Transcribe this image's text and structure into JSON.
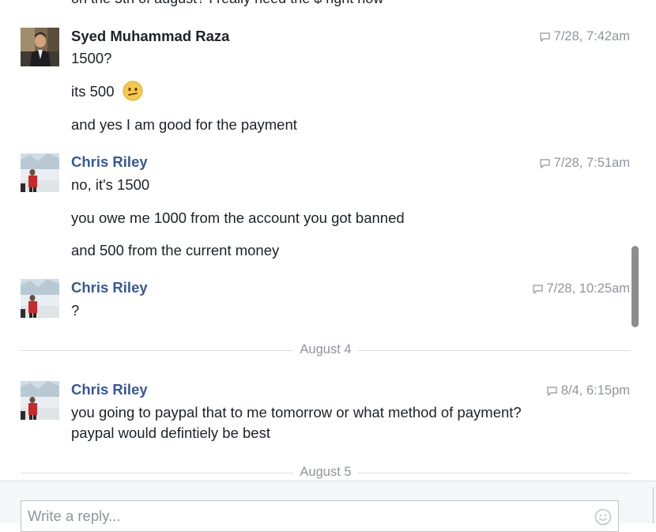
{
  "conversation": {
    "cut_off_text": "on the 5th of august? I really need the $ right now",
    "groups": [
      {
        "author": "Syed Muhammad Raza",
        "timestamp": "7/28, 7:42am",
        "messages": [
          "1500?",
          "its 500",
          "and yes I am good for the payment"
        ],
        "emoji": "confused-face-icon"
      },
      {
        "author": "Chris Riley",
        "timestamp": "7/28, 7:51am",
        "messages": [
          "no, it's 1500",
          "you owe me 1000 from the account you got banned",
          "and 500 from the current money"
        ]
      },
      {
        "author": "Chris Riley",
        "timestamp": "7/28, 10:25am",
        "messages": [
          "?"
        ]
      },
      {
        "author": "Chris Riley",
        "timestamp": "8/4, 6:15pm",
        "messages": [
          "you going to paypal that to me tomorrow or what method of payment?",
          "paypal would defintiely be best"
        ]
      }
    ],
    "dividers": [
      "August 4",
      "August 5"
    ]
  },
  "composer": {
    "placeholder": "Write a reply..."
  },
  "colors": {
    "author_self": "#1d2129",
    "author_other": "#365899",
    "timestamp": "#90949c",
    "divider": "#dadde1",
    "composer_bg": "#f6f7f9"
  }
}
